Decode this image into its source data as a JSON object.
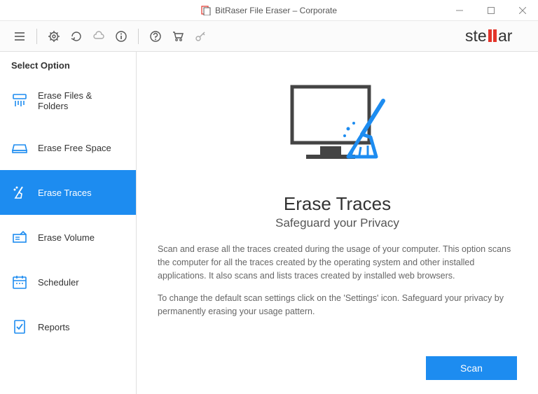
{
  "window": {
    "title": "BitRaser File Eraser – Corporate"
  },
  "brand": {
    "name": "stellar",
    "accent": "#e3342a"
  },
  "sidebar": {
    "header": "Select Option",
    "items": [
      {
        "label": "Erase Files & Folders",
        "icon": "shredder-icon",
        "active": false
      },
      {
        "label": "Erase Free Space",
        "icon": "drive-icon",
        "active": false
      },
      {
        "label": "Erase Traces",
        "icon": "broom-icon",
        "active": true
      },
      {
        "label": "Erase Volume",
        "icon": "volume-icon",
        "active": false
      },
      {
        "label": "Scheduler",
        "icon": "calendar-icon",
        "active": false
      },
      {
        "label": "Reports",
        "icon": "report-icon",
        "active": false
      }
    ]
  },
  "content": {
    "title": "Erase Traces",
    "subtitle": "Safeguard your Privacy",
    "paragraph1": "Scan and erase all the traces created during the usage of your computer. This option scans the computer for all the traces created by the operating system and other installed applications. It also scans and lists traces created by installed web browsers.",
    "paragraph2": "To change the default scan settings click on the 'Settings' icon. Safeguard your privacy by permanently erasing your usage pattern.",
    "scan_button": "Scan"
  }
}
